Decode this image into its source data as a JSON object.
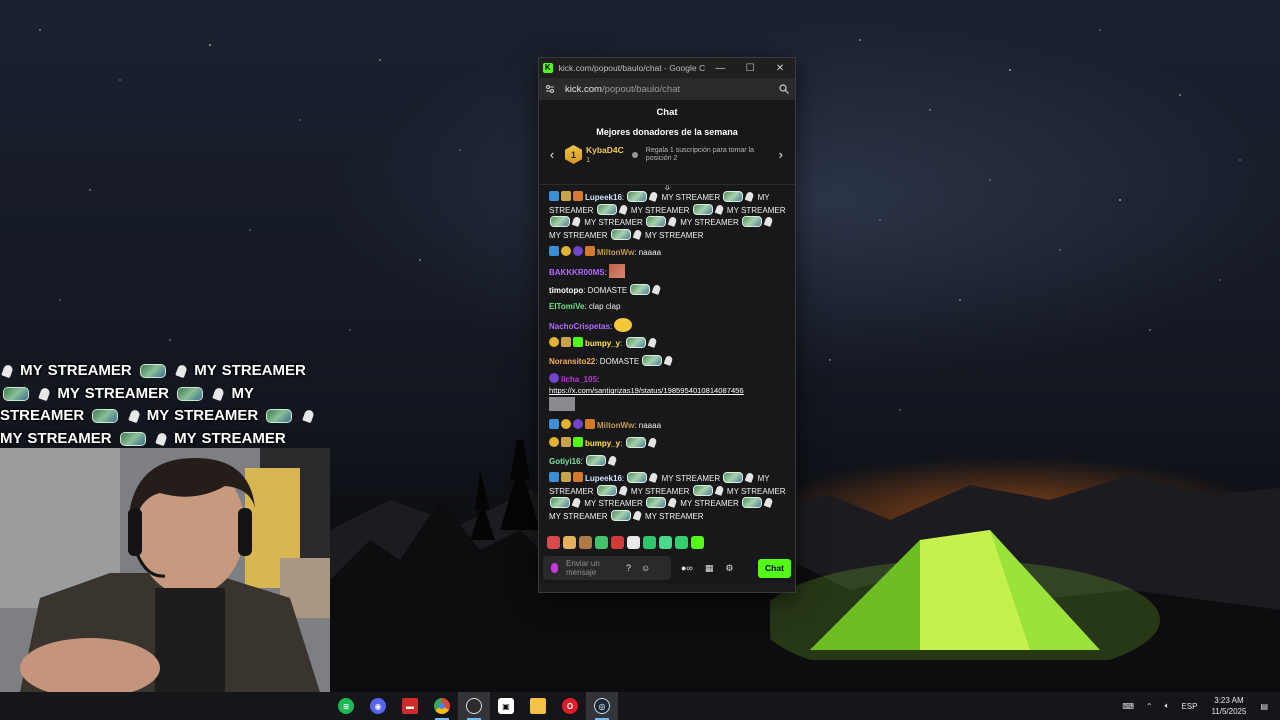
{
  "overlay": {
    "line1": "MY STREAMER",
    "line2": "MY STREAMER",
    "line3": "MY STREAMER",
    "line4": "MY",
    "line5": "STREAMER",
    "line6": "MY STREAMER",
    "line7": "MY STREAMER",
    "line8": "MY STREAMER"
  },
  "window": {
    "title": "kick.com/popout/baulo/chat - Google C...",
    "minimize": "—",
    "maximize": "☐",
    "close": "✕",
    "url_host": "kick.com",
    "url_path": "/popout/baulo/chat"
  },
  "chat": {
    "header": "Chat",
    "donors_title": "Mejores donadores de la semana",
    "donor": {
      "rank": "1",
      "name": "KybaD4C",
      "count": "1",
      "hint": "Regala 1 suscripción para tomar la posición 2"
    },
    "messages": [
      {
        "user": "Lupeek16",
        "text_a": "MY STREAMER",
        "text_b": "MY",
        "text_c": "STREAMER",
        "text_d": "MY STREAMER",
        "text_e": "MY",
        "text_f": "STREAMER",
        "text_g": "MY STREAMER",
        "text_h": "MY",
        "text_i": "STREAMER",
        "text_j": "MY STREAMER",
        "text_k": "MY",
        "text_l": "STREAMER",
        "color": "#cfe4ff"
      },
      {
        "user": "MiltonWw",
        "text": "naaaa",
        "color": "#c49a52"
      },
      {
        "user": "BAKKKR00MS",
        "text": "",
        "color": "#b06cff"
      },
      {
        "user": "timotopo",
        "text": "DOMASTE",
        "color": "#ffffff"
      },
      {
        "user": "ElTomiVe",
        "text": "clap clap",
        "color": "#6fe07e"
      },
      {
        "user": "NachoCrispetas",
        "text": "",
        "color": "#b06cff"
      },
      {
        "user": "bumpy_y",
        "text": "",
        "color": "#ffe24a"
      },
      {
        "user": "Noransito22",
        "text": "DOMASTE",
        "color": "#f4b15b"
      },
      {
        "user": "licha_105",
        "text": "https://x.com/santigrizas19/status/1985954010814087456",
        "color": "#b63bd3"
      },
      {
        "user": "MiltonWw",
        "text": "naaaa",
        "color": "#c49a52"
      },
      {
        "user": "bumpy_y",
        "text": "",
        "color": "#ffe24a"
      },
      {
        "user": "Gotiyi16",
        "text": "",
        "color": "#7ee0a0"
      },
      {
        "user": "Lupeek16",
        "text_a": "MY STREAMER",
        "text_b": "MY",
        "text_c": "STREAMER",
        "text_d": "MY STREAMER",
        "text_e": "MY",
        "text_f": "STREAMER",
        "text_g": "MY STREAMER",
        "text_h": "MY",
        "text_i": "STREAMER",
        "text_j": "MY STREAMER",
        "text_k": "MY",
        "text_l": "STREAMER",
        "color": "#cfe4ff"
      }
    ],
    "input_placeholder": "Enviar un mensaje",
    "send_label": "Chat"
  },
  "colors": {
    "kick_green": "#53fc18",
    "taskbar_bg": "#15161a"
  },
  "taskbar": {
    "apps": [
      {
        "name": "spotify",
        "icon": "spotify-icon",
        "color": "#1db954"
      },
      {
        "name": "discord",
        "icon": "discord-icon",
        "color": "#5865f2"
      },
      {
        "name": "obs-video",
        "icon": "video-app-icon",
        "color": "#d12a2a"
      },
      {
        "name": "chrome",
        "icon": "chrome-icon",
        "color": "#4285f4"
      },
      {
        "name": "obs",
        "icon": "obs-icon",
        "color": "#2b2b2b"
      },
      {
        "name": "epic",
        "icon": "app-icon",
        "color": "#ffffff"
      },
      {
        "name": "explorer",
        "icon": "folder-icon",
        "color": "#f6c244"
      },
      {
        "name": "opera",
        "icon": "opera-icon",
        "color": "#e11d2a"
      },
      {
        "name": "steam",
        "icon": "steam-icon",
        "color": "#1b2838"
      }
    ],
    "lang": "ESP",
    "time": "3:23 AM",
    "date": "11/5/2025"
  }
}
